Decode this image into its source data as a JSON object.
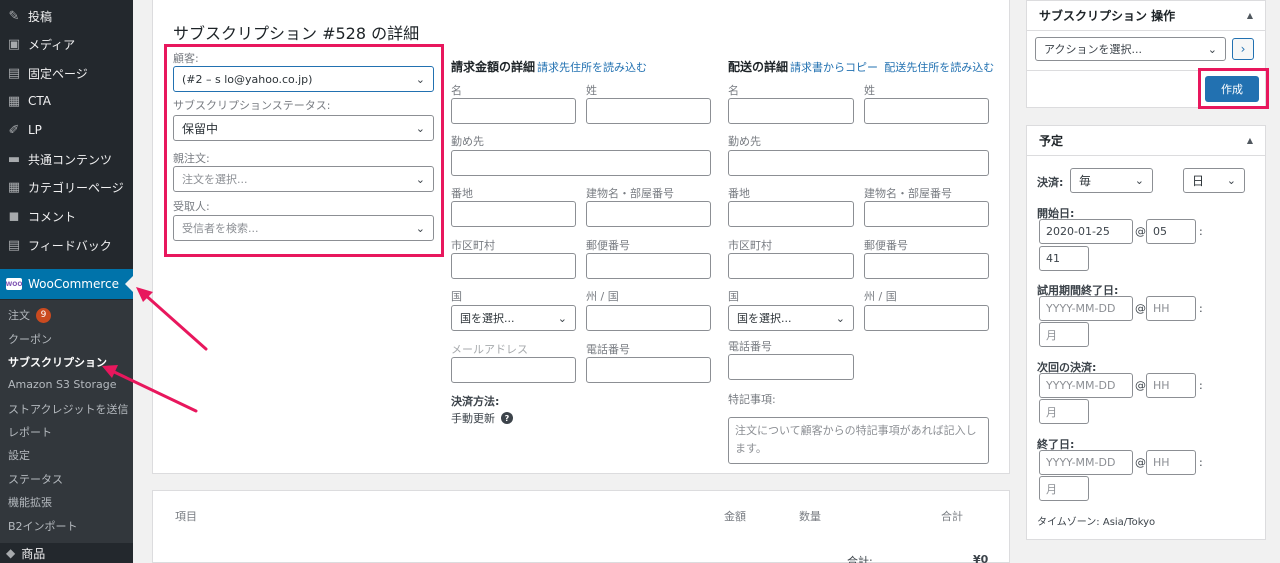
{
  "sidebar": {
    "items": [
      {
        "label": "投稿",
        "icon": "pin-icon"
      },
      {
        "label": "メディア",
        "icon": "media-icon"
      },
      {
        "label": "固定ページ",
        "icon": "page-icon"
      },
      {
        "label": "CTA",
        "icon": "cta-icon"
      },
      {
        "label": "LP",
        "icon": "edit-icon"
      },
      {
        "label": "共通コンテンツ",
        "icon": "folder-icon"
      },
      {
        "label": "カテゴリーページ",
        "icon": "grid-icon"
      },
      {
        "label": "コメント",
        "icon": "comment-icon"
      },
      {
        "label": "フィードバック",
        "icon": "feedback-icon"
      }
    ],
    "woocommerce": {
      "label": "WooCommerce",
      "icon_text": "WOO"
    },
    "submenu": [
      {
        "label": "注文",
        "badge": "9"
      },
      {
        "label": "クーポン"
      },
      {
        "label": "サブスクリプション",
        "current": true
      },
      {
        "label": "Amazon S3 Storage"
      },
      {
        "label": "ストアクレジットを送信"
      },
      {
        "label": "レポート"
      },
      {
        "label": "設定"
      },
      {
        "label": "ステータス"
      },
      {
        "label": "機能拡張"
      },
      {
        "label": "B2インポート"
      }
    ],
    "bottom_item": {
      "label": "商品"
    }
  },
  "main": {
    "title": "サブスクリプション #528 の詳細",
    "general": {
      "customer_label": "顧客:",
      "customer_value": "(#2 – s                         lo@yahoo.co.jp)",
      "status_label": "サブスクリプションステータス:",
      "status_value": "保留中",
      "parent_order_label": "親注文:",
      "parent_order_placeholder": "注文を選択...",
      "recipient_label": "受取人:",
      "recipient_placeholder": "受信者を検索..."
    },
    "billing": {
      "title": "請求金額の詳細",
      "load_link": "請求先住所を読み込む",
      "first_name": "名",
      "last_name": "姓",
      "company": "勤め先",
      "address1": "番地",
      "address2": "建物名・部屋番号",
      "city": "市区町村",
      "postcode": "郵便番号",
      "country": "国",
      "country_placeholder": "国を選択...",
      "state": "州 / 国",
      "email": "メールアドレス",
      "phone": "電話番号",
      "payment_method_label": "決済方法:",
      "payment_method_value": "手動更新",
      "help": "?"
    },
    "shipping": {
      "title": "配送の詳細",
      "copy_link": "請求書からコピー",
      "load_link": "配送先住所を読み込む",
      "first_name": "名",
      "last_name": "姓",
      "company": "勤め先",
      "address1": "番地",
      "address2": "建物名・部屋番号",
      "city": "市区町村",
      "postcode": "郵便番号",
      "country": "国",
      "country_placeholder": "国を選択...",
      "state": "州 / 国",
      "phone": "電話番号",
      "note_label": "特記事項:",
      "note_placeholder": "注文について顧客からの特記事項があれば記入します。"
    }
  },
  "items_panel": {
    "col_item": "項目",
    "col_amount": "金額",
    "col_qty": "数量",
    "col_total": "合計",
    "subtotal_label": "合計:",
    "subtotal_value": "¥0"
  },
  "actions_box": {
    "title": "サブスクリプション 操作",
    "select_placeholder": "アクションを選択...",
    "go": "›",
    "create": "作成"
  },
  "schedule_box": {
    "title": "予定",
    "billing_label": "決済:",
    "interval_value": "毎",
    "period_value": "日",
    "start_label": "開始日:",
    "start_date": "2020-01-25",
    "start_hour": "05",
    "start_minute": "41",
    "trial_label": "試用期間終了日:",
    "next_label": "次回の決済:",
    "end_label": "終了日:",
    "date_placeholder": "YYYY-MM-DD",
    "hour_placeholder": "HH",
    "minute_placeholder": "月",
    "at": "@",
    "colon": ":",
    "timezone": "タイムゾーン: Asia/Tokyo"
  },
  "colors": {
    "highlight": "#e8175d",
    "primary": "#2271b1",
    "sidebar": "#23282d",
    "woo_active": "#0073aa"
  }
}
